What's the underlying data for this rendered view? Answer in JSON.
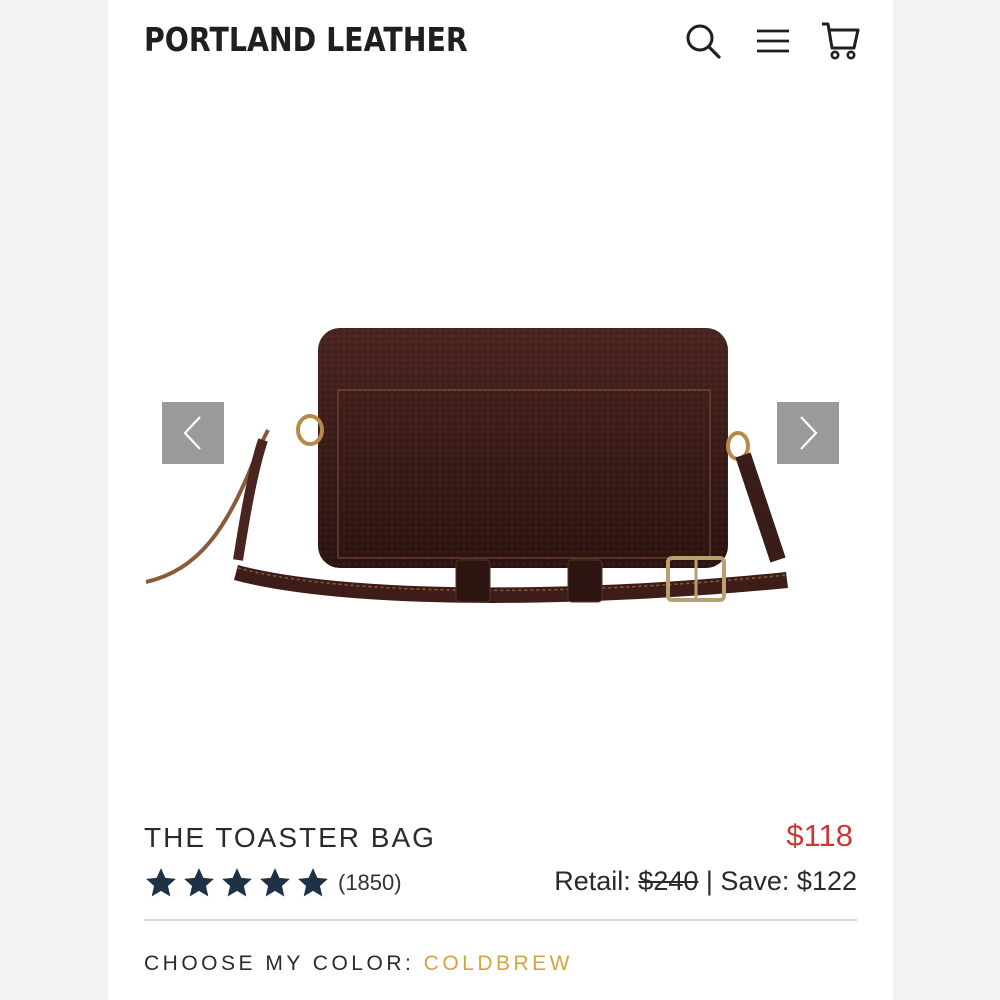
{
  "header": {
    "brand": "PORTLAND LEATHER",
    "icons": [
      "search-icon",
      "menu-icon",
      "cart-icon"
    ]
  },
  "gallery": {
    "image": "brown-leather-crossbody-bag",
    "prev_icon": "chevron-left-icon",
    "next_icon": "chevron-right-icon"
  },
  "product": {
    "name": "THE TOASTER BAG",
    "price": "$118",
    "rating": 5,
    "review_count": "(1850)",
    "retail_label": "Retail: ",
    "retail_price": "$240",
    "save_text": " | Save: $122"
  },
  "color": {
    "label": "CHOOSE MY COLOR: ",
    "value": "COLDBREW"
  },
  "colors": {
    "price_red": "#c53b35",
    "star_navy": "#1e3247",
    "color_gold": "#d4a53c",
    "arrow_gray": "#9a9a9a"
  }
}
